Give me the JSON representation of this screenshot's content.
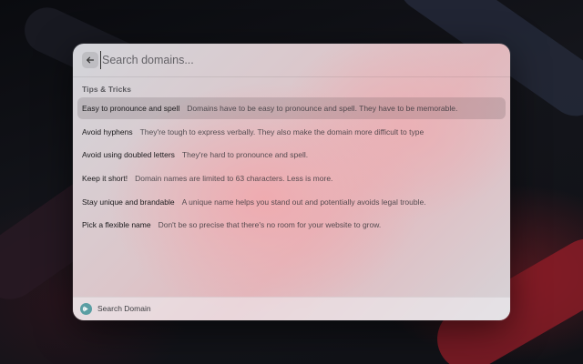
{
  "search": {
    "placeholder": "Search domains..."
  },
  "section": {
    "title": "Tips & Tricks"
  },
  "tips": [
    {
      "title": "Easy to pronounce and spell",
      "description": "Domains have to be easy to pronounce and spell. They have to be memorable.",
      "selected": true
    },
    {
      "title": "Avoid hyphens",
      "description": "They're tough to express verbally. They also make the domain more difficult to type",
      "selected": false
    },
    {
      "title": "Avoid using doubled letters",
      "description": "They're hard to pronounce and spell.",
      "selected": false
    },
    {
      "title": "Keep it short!",
      "description": "Domain names are limited to 63 characters. Less is more.",
      "selected": false
    },
    {
      "title": "Stay unique and brandable",
      "description": "A unique name helps you stand out and potentially avoids legal trouble.",
      "selected": false
    },
    {
      "title": "Pick a flexible name",
      "description": "Don't be so precise that there's no room for your website to grow.",
      "selected": false
    }
  ],
  "footer": {
    "label": "Search Domain",
    "icon": "extension-icon"
  },
  "colors": {
    "footer_icon": "#5a9ea3",
    "selected_row": "rgba(70,60,65,0.18)"
  }
}
